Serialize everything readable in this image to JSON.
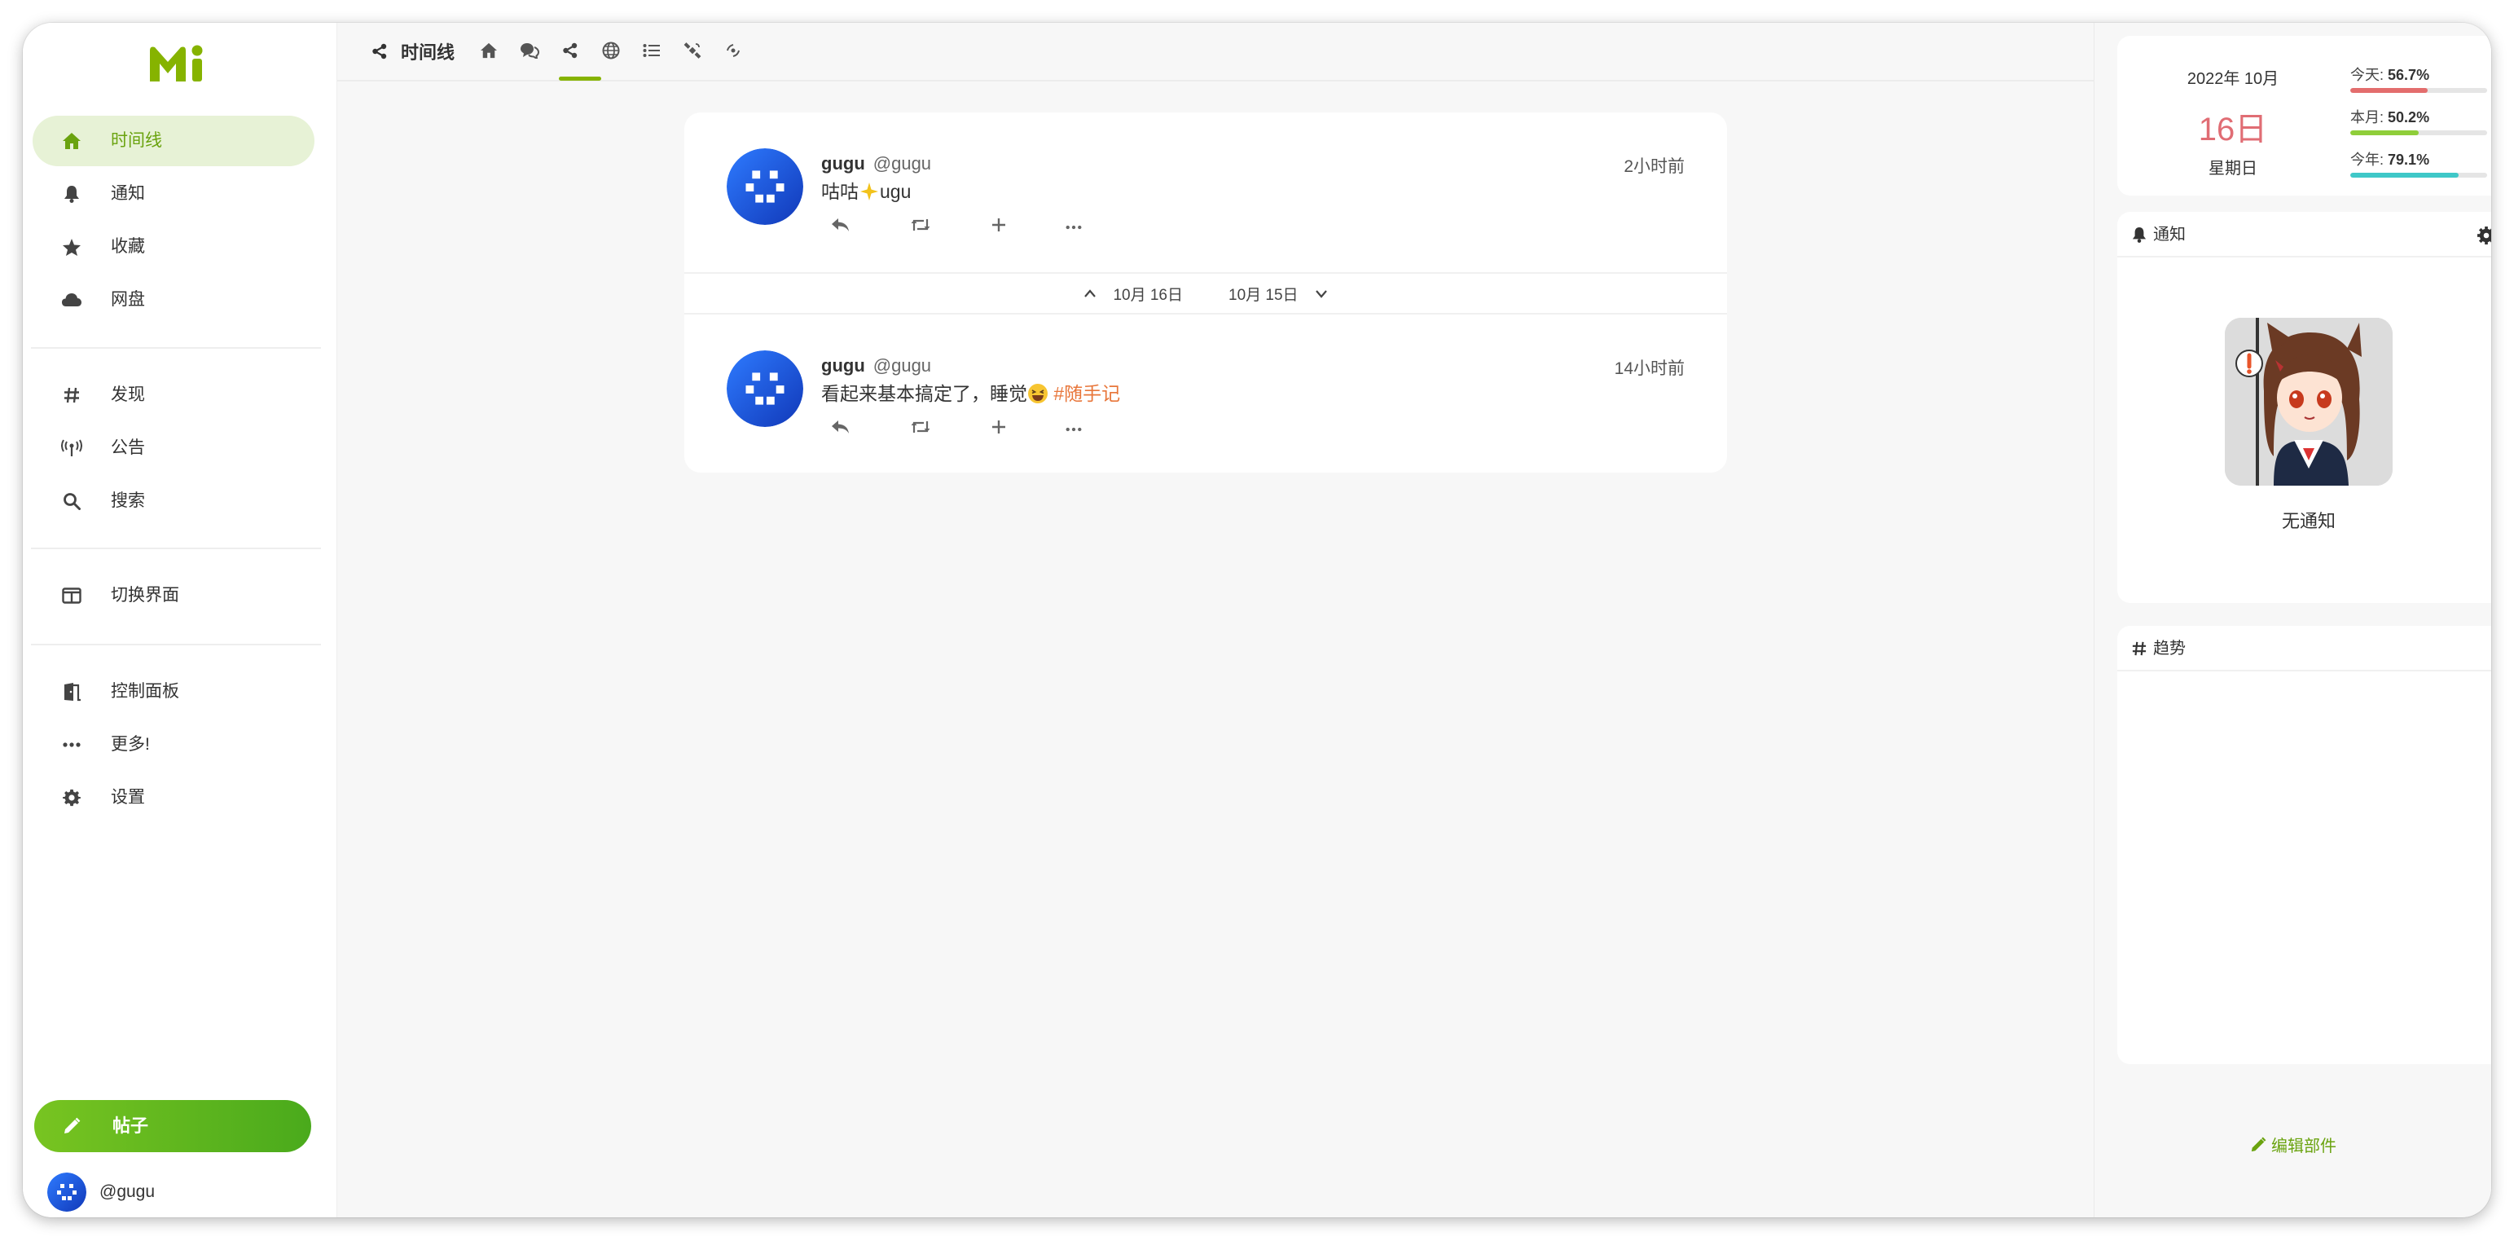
{
  "app": {
    "logo_text": "Mi",
    "accent": "#86b300"
  },
  "sidebar": {
    "items": [
      {
        "label": "时间线",
        "icon": "home-icon",
        "active": true
      },
      {
        "label": "通知",
        "icon": "bell-icon"
      },
      {
        "label": "收藏",
        "icon": "star-icon"
      },
      {
        "label": "网盘",
        "icon": "cloud-icon"
      },
      {
        "label": "发现",
        "icon": "hashtag-icon"
      },
      {
        "label": "公告",
        "icon": "broadcast-icon"
      },
      {
        "label": "搜索",
        "icon": "search-icon"
      },
      {
        "label": "切换界面",
        "icon": "columns-icon"
      },
      {
        "label": "控制面板",
        "icon": "door-icon"
      },
      {
        "label": "更多!",
        "icon": "ellipsis-icon"
      },
      {
        "label": "设置",
        "icon": "gear-icon"
      }
    ],
    "post_button": "帖子",
    "account": "@gugu"
  },
  "header": {
    "title": "时间线",
    "tabs": [
      "home-icon",
      "comments-icon",
      "share-icon",
      "globe-icon",
      "list-icon",
      "satellite-icon",
      "antenna-icon"
    ],
    "active_tab": 2
  },
  "timeline": {
    "notes": [
      {
        "name": "gugu",
        "handle": "@gugu",
        "time": "2小时前",
        "text_before": "咕咕",
        "text_after": "ugu",
        "hashtag": ""
      },
      {
        "name": "gugu",
        "handle": "@gugu",
        "time": "14小时前",
        "text_before": "看起来基本搞定了，睡觉",
        "text_after": "",
        "hashtag": "#随手记"
      }
    ],
    "date_separator": {
      "newer": "10月 16日",
      "older": "10月 15日"
    }
  },
  "calendar": {
    "year_month": "2022年 10月",
    "day": "16日",
    "weekday": "星期日",
    "stats": [
      {
        "label": "今天:",
        "value": "56.7%",
        "percent": 56.7,
        "color": "#e36d6d"
      },
      {
        "label": "本月:",
        "value": "50.2%",
        "percent": 50.2,
        "color": "#8fce3a"
      },
      {
        "label": "今年:",
        "value": "79.1%",
        "percent": 79.1,
        "color": "#3fc8c8"
      }
    ]
  },
  "notifications_widget": {
    "title": "通知",
    "empty_text": "无通知"
  },
  "trends_widget": {
    "title": "趋势"
  },
  "edit_widgets": "编辑部件"
}
